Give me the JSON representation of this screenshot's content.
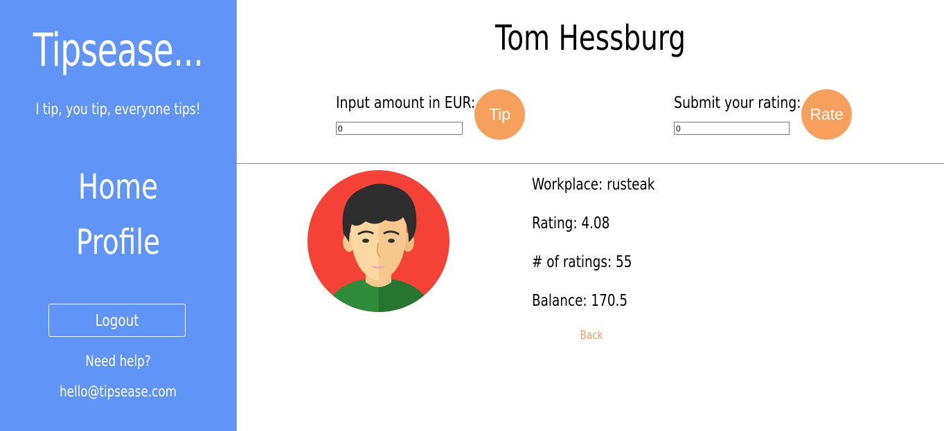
{
  "sidebar": {
    "brand": "Tipsease...",
    "tagline": "I tip, you tip, everyone tips!",
    "nav": {
      "home": "Home",
      "profile": "Profile"
    },
    "logout_label": "Logout",
    "help_text": "Need help?",
    "email": "hello@tipsease.com"
  },
  "main": {
    "name": "Tom Hessburg",
    "tip": {
      "label": "Input amount in EUR:",
      "value": "0",
      "button": "Tip"
    },
    "rate": {
      "label": "Submit your rating:",
      "value": "0",
      "button": "Rate"
    },
    "details": {
      "workplace": "Workplace: rusteak",
      "rating": "Rating: 4.08",
      "num_ratings": "# of ratings: 55",
      "balance": "Balance: 170.5"
    },
    "back_label": "Back"
  },
  "colors": {
    "sidebar_bg": "#6095f7",
    "accent_orange": "#f79f5c",
    "avatar_bg": "#f44336",
    "shirt_green": "#2e8b3a"
  },
  "avatar_icon": "user-avatar-icon"
}
